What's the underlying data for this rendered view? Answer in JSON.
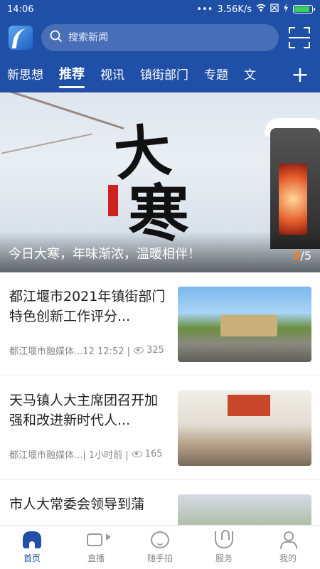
{
  "status": {
    "time": "14:06",
    "signal_dots": "•••",
    "speed": "3.56K/s",
    "wifi_icon": "wifi-icon",
    "battery_level": 0.9
  },
  "header": {
    "search_placeholder": "搜索新闻",
    "logo_icon": "app-logo",
    "scan_icon": "scan-icon"
  },
  "tabs": [
    {
      "label": "新思想"
    },
    {
      "label": "推荐"
    },
    {
      "label": "视讯"
    },
    {
      "label": "镇街部门"
    },
    {
      "label": "专题"
    },
    {
      "label": "文"
    }
  ],
  "active_tab": 1,
  "add_tab_symbol": "+",
  "banner": {
    "glyph_1": "大",
    "glyph_2": "寒",
    "caption": "今日大寒，年味渐浓，温暖相伴！",
    "page_current": "3",
    "page_total": "/5"
  },
  "feed": [
    {
      "title": "都江堰市2021年镇街部门特色创新工作评分...",
      "source": "都江堰市融媒体...12 12:52 | ",
      "views": "325"
    },
    {
      "title": "天马镇人大主席团召开加强和改进新时代人...",
      "source": "都江堰市融媒体...| 1小时前 | ",
      "views": "165"
    },
    {
      "title": "市人大常委会领导到蒲",
      "source": "",
      "views": ""
    }
  ],
  "bottom_nav": [
    {
      "label": "首页",
      "icon": "home-icon"
    },
    {
      "label": "直播",
      "icon": "video-icon"
    },
    {
      "label": "随手拍",
      "icon": "chat-icon"
    },
    {
      "label": "服务",
      "icon": "service-icon"
    },
    {
      "label": "我的",
      "icon": "profile-icon"
    }
  ],
  "colors": {
    "brand_blue": "#1f4fa6",
    "accent_orange": "#ff7a1a"
  }
}
